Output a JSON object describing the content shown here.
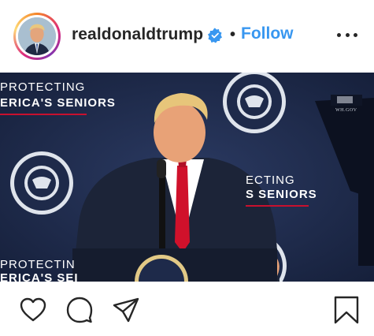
{
  "header": {
    "username": "realdonaldtrump",
    "follow_label": "Follow",
    "separator": "•",
    "avatar_icon": "profile-avatar",
    "verified_icon": "verified-badge-icon",
    "more_icon": "more-options-icon"
  },
  "media": {
    "banner_line1_top": "PROTECTING",
    "banner_line2_top": "ERICA'S SENIORS",
    "banner_line1_mid": "ECTING",
    "banner_line2_mid": "S SENIORS",
    "banner_line1_bottom": "PROTECTIN",
    "banner_line2_bottom": "ERICA'S SEI",
    "teleprompter_text": "WH.GOV",
    "backdrop_color": "#1e2a4a",
    "accent_red": "#c8102e"
  },
  "actions": {
    "like_icon": "heart-icon",
    "comment_icon": "comment-icon",
    "share_icon": "paper-plane-icon",
    "save_icon": "bookmark-icon"
  },
  "colors": {
    "follow_blue": "#3897f0",
    "verified_blue": "#3897f0",
    "text": "#262626"
  }
}
